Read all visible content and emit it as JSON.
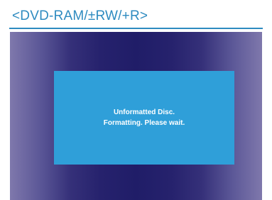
{
  "header": {
    "title": "<DVD-RAM/±RW/+R>"
  },
  "dialog": {
    "line1": "Unformatted Disc.",
    "line2": "Formatting. Please wait."
  },
  "colors": {
    "heading": "#2e8bc0",
    "dialog_background": "#2f9fd9",
    "screen_center": "#201d68",
    "screen_edge": "#7f78ac",
    "dialog_text": "#ffffff"
  }
}
